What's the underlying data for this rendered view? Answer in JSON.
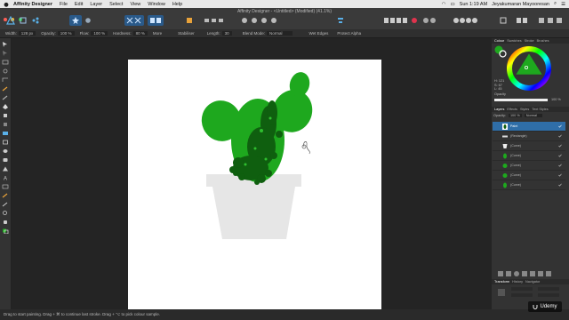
{
  "menubar": {
    "app_name": "Affinity Designer",
    "items": [
      "File",
      "Edit",
      "Layer",
      "Select",
      "View",
      "Window",
      "Help"
    ],
    "time": "Sun 1:19 AM",
    "user": "Jeyakumaran Mayooresan"
  },
  "window": {
    "title": "Affinity Designer - <Untitled> (Modified) (41.1%)"
  },
  "context_bar": {
    "width_label": "Width:",
    "width_value": "128 px",
    "opacity_label": "Opacity:",
    "opacity_value": "100 %",
    "flow_label": "Flow:",
    "flow_value": "100 %",
    "hardness_label": "Hardness:",
    "hardness_value": "80 %",
    "more_label": "More",
    "stabiliser_label": "Stabiliser",
    "length_label": "Length:",
    "length_value": "30",
    "blend_label": "Blend Mode:",
    "blend_value": "Normal",
    "wet_edges_label": "Wet Edges",
    "protect_alpha_label": "Protect Alpha"
  },
  "color_panel": {
    "tabs": [
      "Colour",
      "Swatches",
      "Stroke",
      "Brushes"
    ],
    "h": "H: 121",
    "s": "S: 67",
    "l": "L: 45",
    "opacity_label": "Opacity",
    "opacity_value": "100 %"
  },
  "layers_panel": {
    "tabs": [
      "Layers",
      "Effects",
      "Styles",
      "Text Styles"
    ],
    "opacity_label": "Opacity:",
    "opacity_value": "100 %",
    "blend_value": "Normal",
    "layers": [
      {
        "name": "Paint",
        "selected": true
      },
      {
        "name": "(Rectangle)",
        "selected": false
      },
      {
        "name": "(Curve)",
        "selected": false
      },
      {
        "name": "(Curve)",
        "selected": false
      },
      {
        "name": "(Curve)",
        "selected": false
      },
      {
        "name": "(Curve)",
        "selected": false
      },
      {
        "name": "(Curve)",
        "selected": false
      }
    ]
  },
  "transform_panel": {
    "tabs": [
      "Transform",
      "History",
      "Navigator"
    ]
  },
  "status": {
    "text": "Drag to start painting. Drag + ⌘ to continue last stroke. Drag + ⌥ to pick colour sample."
  },
  "watermark": {
    "label": "Udemy"
  },
  "colors": {
    "accent": "#2f6ea8",
    "leaf_green": "#1ea81e",
    "paint_dark_green": "#0f5f0f",
    "pot_grey": "#e6e6e6"
  }
}
